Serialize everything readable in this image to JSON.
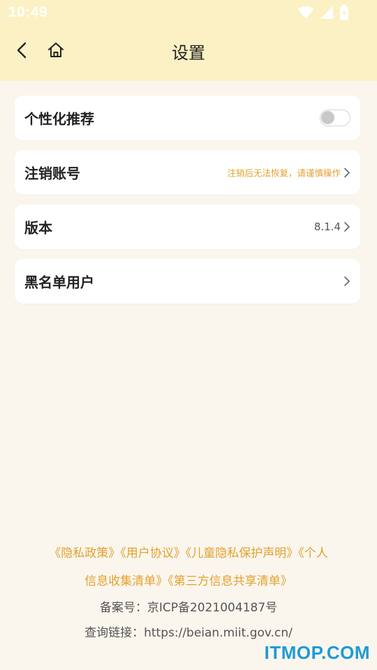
{
  "status_bar": {
    "time": "10:49",
    "icons": [
      "wifi-icon",
      "signal-icon",
      "battery-icon"
    ]
  },
  "nav": {
    "title": "设置",
    "back_icon": "back-arrow-icon",
    "home_icon": "home-icon"
  },
  "settings": {
    "personalized": {
      "label": "个性化推荐",
      "enabled": false
    },
    "cancel_account": {
      "label": "注销账号",
      "hint": "注销后无法恢复，请谨慎操作"
    },
    "version": {
      "label": "版本",
      "value": "8.1.4"
    },
    "blacklist": {
      "label": "黑名单用户"
    }
  },
  "footer": {
    "links": [
      "《隐私政策》",
      "《用户协议》",
      "《儿童隐私保护声明》",
      "《个人信息收集清单》",
      "《第三方信息共享清单》"
    ],
    "record": "备案号：京ICP备2021004187号",
    "query": "查询链接：https://beian.miit.gov.cn/"
  },
  "watermark": "ITMOP.COM",
  "colors": {
    "header_bg": "#fbf1c4",
    "page_bg": "#faf6ee",
    "accent_orange": "#e2a12d",
    "watermark_blue": "#1e9ad6"
  }
}
